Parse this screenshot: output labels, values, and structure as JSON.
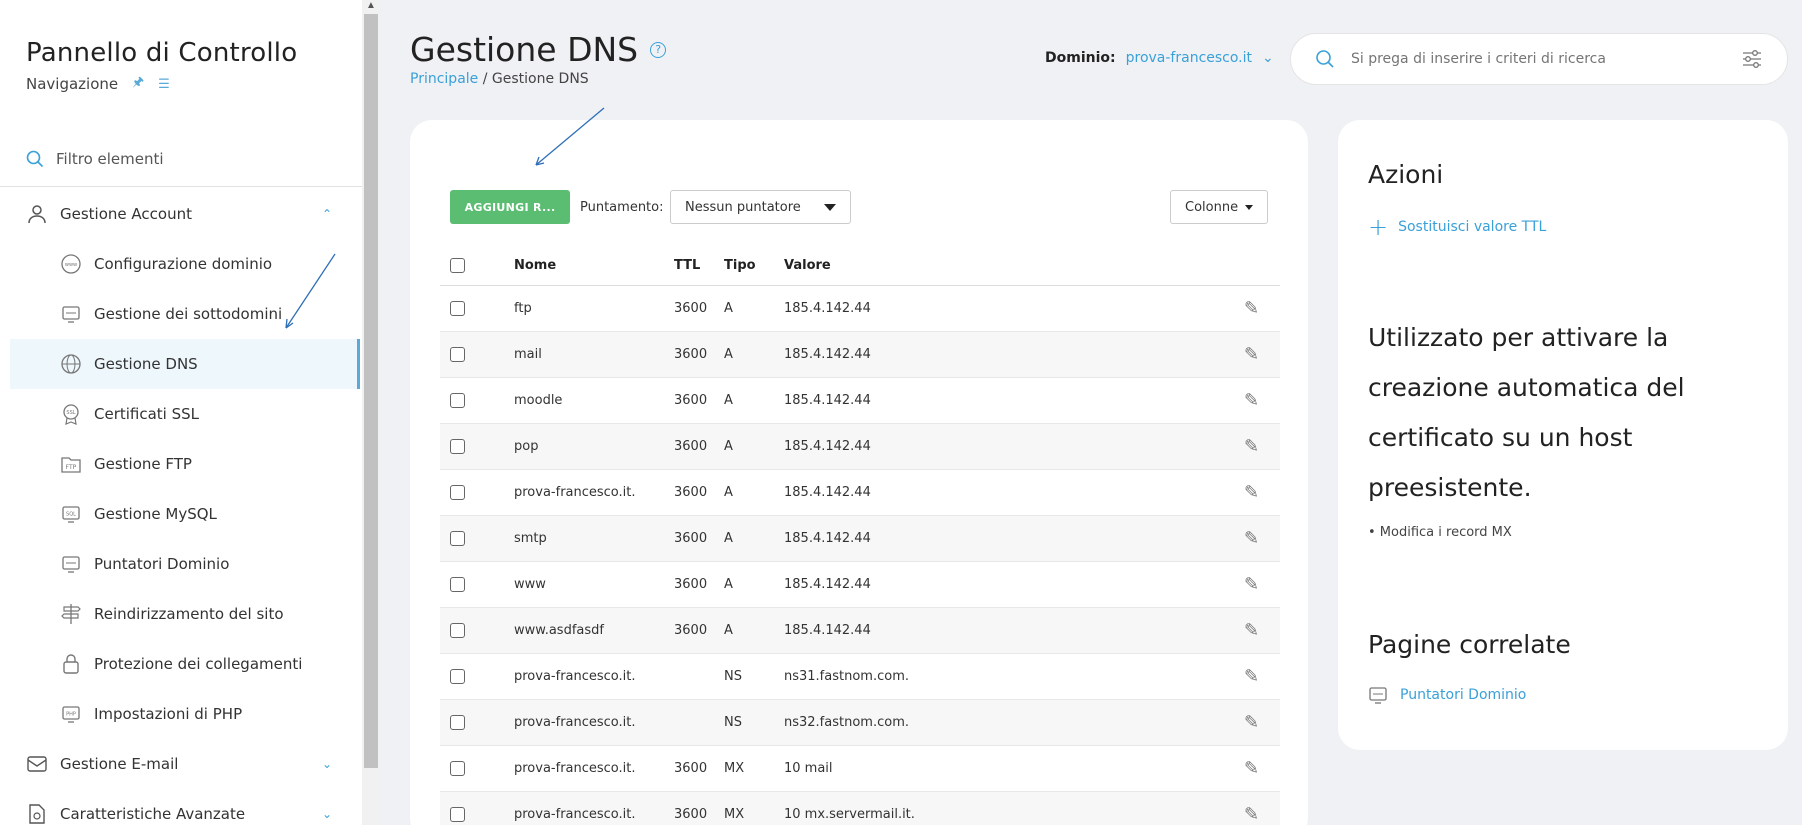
{
  "sidebar": {
    "title": "Pannello di Controllo",
    "subtitle": "Navigazione",
    "filter_placeholder": "Filtro elementi",
    "groups": [
      {
        "label": "Gestione Account",
        "icon": "user-icon"
      },
      {
        "label": "Gestione E-mail",
        "icon": "mail-icon"
      },
      {
        "label": "Caratteristiche Avanzate",
        "icon": "advanced-icon"
      }
    ],
    "items": [
      {
        "label": "Configurazione dominio",
        "icon": "www-icon"
      },
      {
        "label": "Gestione dei sottodomini",
        "icon": "monitor-icon"
      },
      {
        "label": "Gestione DNS",
        "icon": "dns-icon"
      },
      {
        "label": "Certificati SSL",
        "icon": "ssl-icon"
      },
      {
        "label": "Gestione FTP",
        "icon": "ftp-icon"
      },
      {
        "label": "Gestione MySQL",
        "icon": "sql-icon"
      },
      {
        "label": "Puntatori Dominio",
        "icon": "monitor-icon"
      },
      {
        "label": "Reindirizzamento del sito",
        "icon": "signpost-icon"
      },
      {
        "label": "Protezione dei collegamenti",
        "icon": "lock-icon"
      },
      {
        "label": "Impostazioni di PHP",
        "icon": "php-icon"
      }
    ]
  },
  "header": {
    "title": "Gestione DNS",
    "breadcrumb_home": "Principale",
    "breadcrumb_sep": " / ",
    "breadcrumb_current": "Gestione DNS",
    "domain_label": "Dominio:",
    "domain_value": "prova-francesco.it",
    "search_placeholder": "Si prega di inserire i criteri di ricerca"
  },
  "toolbar": {
    "add_label": "AGGIUNGI R...",
    "pointing_label": "Puntamento:",
    "pointing_value": "Nessun puntatore",
    "columns_label": "Colonne"
  },
  "table": {
    "headers": {
      "nome": "Nome",
      "ttl": "TTL",
      "tipo": "Tipo",
      "valore": "Valore"
    },
    "rows": [
      {
        "nome": "ftp",
        "ttl": "3600",
        "tipo": "A",
        "valore": "185.4.142.44"
      },
      {
        "nome": "mail",
        "ttl": "3600",
        "tipo": "A",
        "valore": "185.4.142.44"
      },
      {
        "nome": "moodle",
        "ttl": "3600",
        "tipo": "A",
        "valore": "185.4.142.44"
      },
      {
        "nome": "pop",
        "ttl": "3600",
        "tipo": "A",
        "valore": "185.4.142.44"
      },
      {
        "nome": "prova-francesco.it.",
        "ttl": "3600",
        "tipo": "A",
        "valore": "185.4.142.44"
      },
      {
        "nome": "smtp",
        "ttl": "3600",
        "tipo": "A",
        "valore": "185.4.142.44"
      },
      {
        "nome": "www",
        "ttl": "3600",
        "tipo": "A",
        "valore": "185.4.142.44"
      },
      {
        "nome": "www.asdfasdf",
        "ttl": "3600",
        "tipo": "A",
        "valore": "185.4.142.44"
      },
      {
        "nome": "prova-francesco.it.",
        "ttl": "",
        "tipo": "NS",
        "valore": "ns31.fastnom.com."
      },
      {
        "nome": "prova-francesco.it.",
        "ttl": "",
        "tipo": "NS",
        "valore": "ns32.fastnom.com."
      },
      {
        "nome": "prova-francesco.it.",
        "ttl": "3600",
        "tipo": "MX",
        "valore": "10 mail"
      },
      {
        "nome": "prova-francesco.it.",
        "ttl": "3600",
        "tipo": "MX",
        "valore": "10 mx.servermail.it."
      }
    ]
  },
  "actions": {
    "title": "Azioni",
    "replace_ttl": "Sostituisci valore TTL",
    "description": "Utilizzato per attivare la creazione automatica del certificato su un host preesistente.",
    "note": "• Modifica i record MX",
    "related_title": "Pagine correlate",
    "related_link": "Puntatori Dominio"
  },
  "colors": {
    "accent": "#3aa0d8",
    "add_button": "#5bbd72"
  }
}
